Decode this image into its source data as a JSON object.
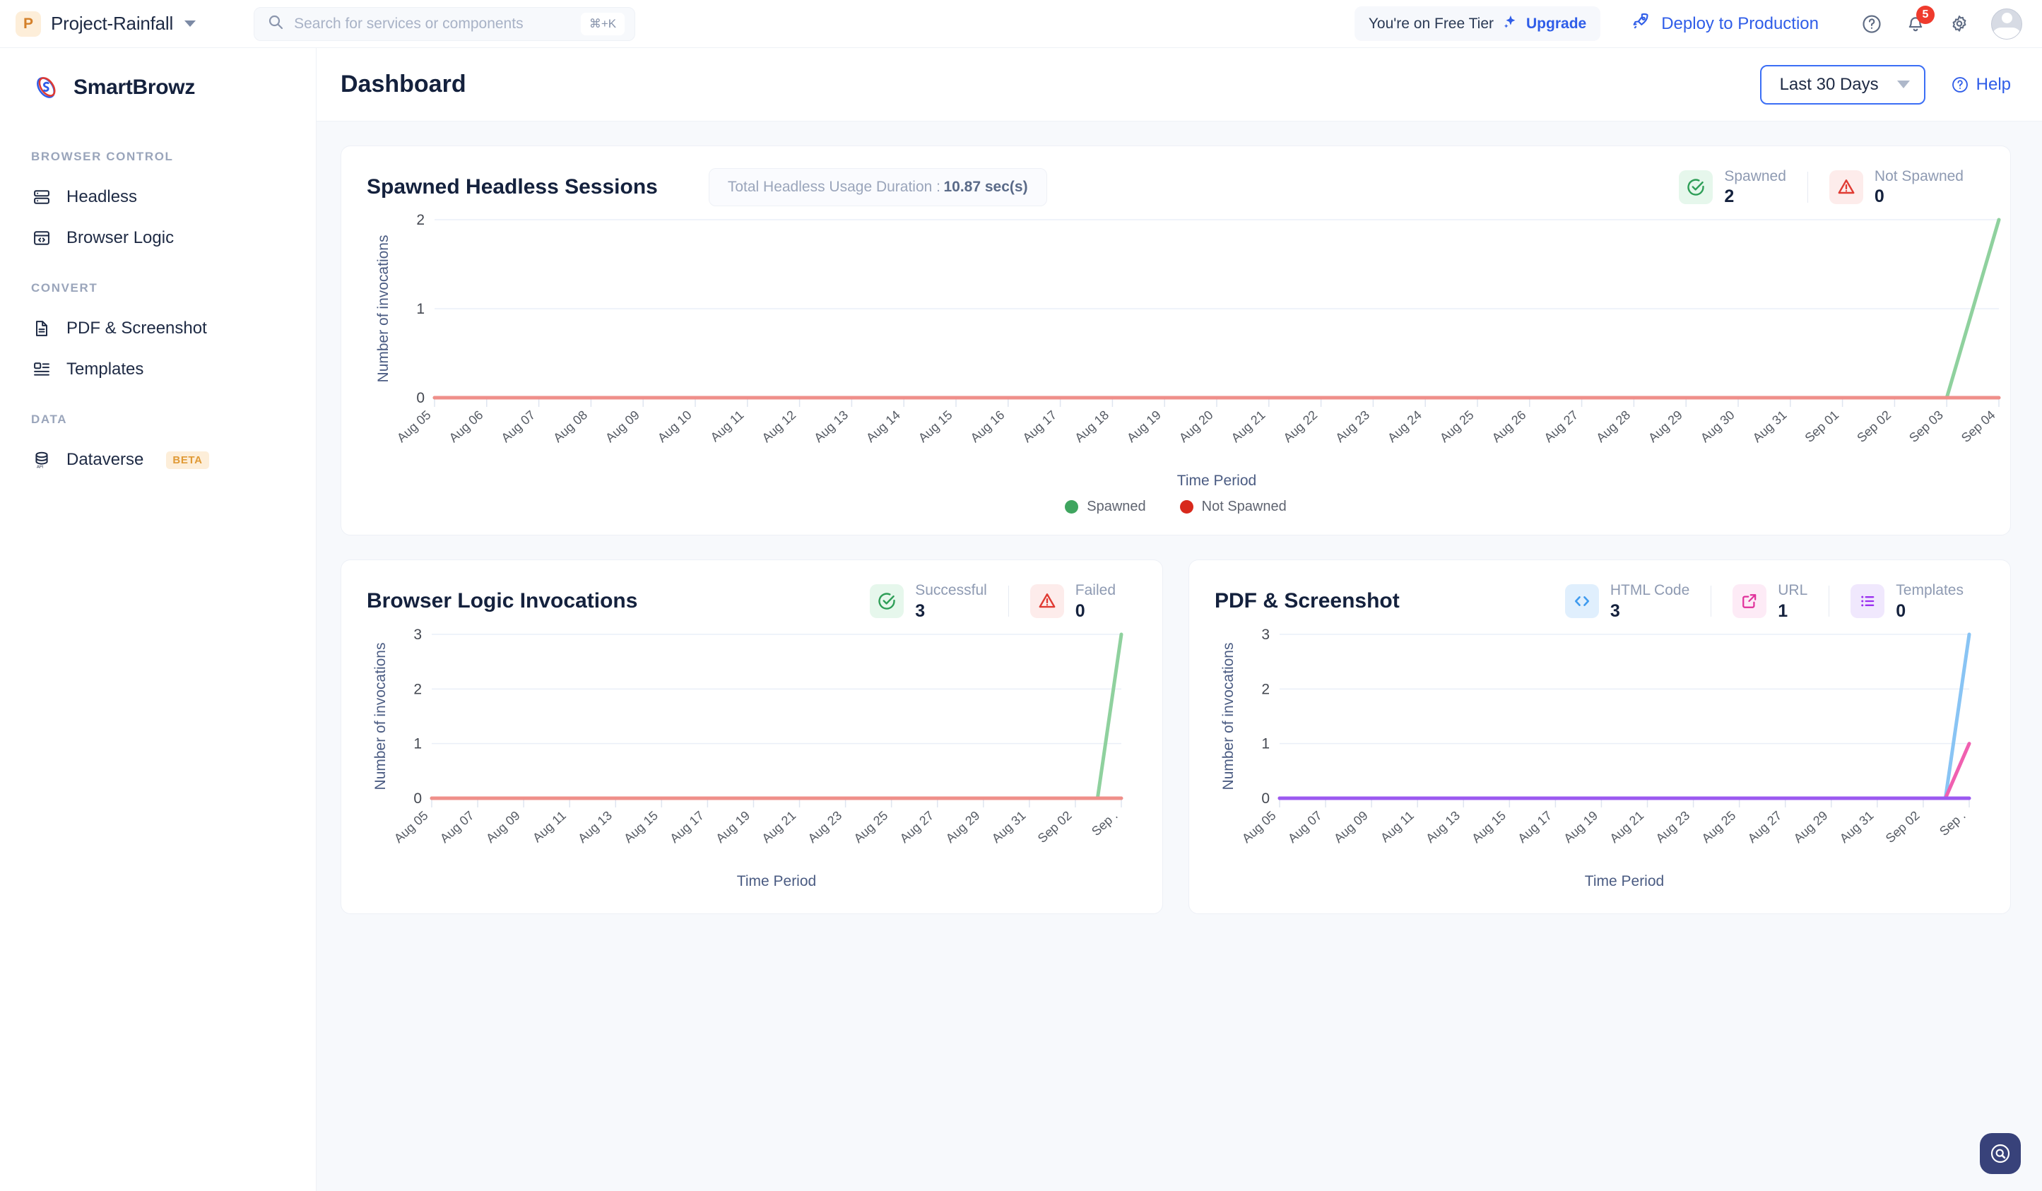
{
  "topbar": {
    "project_initial": "P",
    "project_name": "Project-Rainfall",
    "search_placeholder": "Search for services or components",
    "search_value": "",
    "search_shortcut": "⌘+K",
    "tier_text": "You're on Free Tier",
    "upgrade_label": "Upgrade",
    "deploy_label": "Deploy to Production",
    "notification_count": "5"
  },
  "sidebar": {
    "brand": "SmartBrowz",
    "sections": [
      {
        "title": "BROWSER CONTROL",
        "items": [
          {
            "label": "Headless",
            "icon": "server-icon"
          },
          {
            "label": "Browser Logic",
            "icon": "code-window-icon"
          }
        ]
      },
      {
        "title": "CONVERT",
        "items": [
          {
            "label": "PDF & Screenshot",
            "icon": "document-icon"
          },
          {
            "label": "Templates",
            "icon": "layout-list-icon"
          }
        ]
      },
      {
        "title": "DATA",
        "items": [
          {
            "label": "Dataverse",
            "icon": "database-api-icon",
            "badge": "BETA"
          }
        ]
      }
    ]
  },
  "page": {
    "title": "Dashboard",
    "range_label": "Last 30 Days",
    "help_label": "Help"
  },
  "cards": {
    "headless": {
      "title": "Spawned Headless Sessions",
      "duration_label": "Total Headless Usage Duration :",
      "duration_value": "10.87 sec(s)",
      "stats": [
        {
          "label": "Spawned",
          "value": "2",
          "icon": "check-circle-icon",
          "tone": "green"
        },
        {
          "label": "Not Spawned",
          "value": "0",
          "icon": "warning-triangle-icon",
          "tone": "red"
        }
      ]
    },
    "browser_logic": {
      "title": "Browser Logic Invocations",
      "stats": [
        {
          "label": "Successful",
          "value": "3",
          "icon": "check-circle-icon",
          "tone": "green"
        },
        {
          "label": "Failed",
          "value": "0",
          "icon": "warning-triangle-icon",
          "tone": "red"
        }
      ]
    },
    "pdf_screenshot": {
      "title": "PDF & Screenshot",
      "stats": [
        {
          "label": "HTML Code",
          "value": "3",
          "icon": "code-brackets-icon",
          "tone": "blue"
        },
        {
          "label": "URL",
          "value": "1",
          "icon": "external-link-icon",
          "tone": "pink"
        },
        {
          "label": "Templates",
          "value": "0",
          "icon": "list-icon",
          "tone": "purple"
        }
      ]
    }
  },
  "colors": {
    "accent_blue": "#2f5de8",
    "spawned_green": "#8fd19e",
    "not_spawned_red": "#ef8f8a",
    "html_blue": "#89c4f4",
    "url_pink": "#f060b0",
    "templates_purple": "#9b59f0",
    "beta_amber": "#e09a36"
  },
  "chart_data": [
    {
      "id": "spawned-headless-sessions-chart",
      "type": "line",
      "title": "Spawned Headless Sessions",
      "xlabel": "Time Period",
      "ylabel": "Number of invocations",
      "ylim": [
        0,
        2
      ],
      "yticks": [
        0,
        1,
        2
      ],
      "grid": true,
      "legend_position": "bottom",
      "x": [
        "Aug 05",
        "Aug 06",
        "Aug 07",
        "Aug 08",
        "Aug 09",
        "Aug 10",
        "Aug 11",
        "Aug 12",
        "Aug 13",
        "Aug 14",
        "Aug 15",
        "Aug 16",
        "Aug 17",
        "Aug 18",
        "Aug 19",
        "Aug 20",
        "Aug 21",
        "Aug 22",
        "Aug 23",
        "Aug 24",
        "Aug 25",
        "Aug 26",
        "Aug 27",
        "Aug 28",
        "Aug 29",
        "Aug 30",
        "Aug 31",
        "Sep 01",
        "Sep 02",
        "Sep 03",
        "Sep 04"
      ],
      "tick_labels": [
        "Aug 05",
        "Aug 06",
        "Aug 07",
        "Aug 08",
        "Aug 09",
        "Aug 10",
        "Aug 11",
        "Aug 12",
        "Aug 13",
        "Aug 14",
        "Aug 15",
        "Aug 16",
        "Aug 17",
        "Aug 18",
        "Aug 19",
        "Aug 20",
        "Aug 21",
        "Aug 22",
        "Aug 23",
        "Aug 24",
        "Aug 25",
        "Aug 26",
        "Aug 27",
        "Aug 28",
        "Aug 29",
        "Aug 30",
        "Aug 31",
        "Sep 01",
        "Sep 02",
        "Sep 03",
        "Sep 04"
      ],
      "series": [
        {
          "name": "Spawned",
          "color": "#8fd19e",
          "values": [
            0,
            0,
            0,
            0,
            0,
            0,
            0,
            0,
            0,
            0,
            0,
            0,
            0,
            0,
            0,
            0,
            0,
            0,
            0,
            0,
            0,
            0,
            0,
            0,
            0,
            0,
            0,
            0,
            0,
            0,
            2
          ]
        },
        {
          "name": "Not Spawned",
          "color": "#ef8f8a",
          "values": [
            0,
            0,
            0,
            0,
            0,
            0,
            0,
            0,
            0,
            0,
            0,
            0,
            0,
            0,
            0,
            0,
            0,
            0,
            0,
            0,
            0,
            0,
            0,
            0,
            0,
            0,
            0,
            0,
            0,
            0,
            0
          ]
        }
      ]
    },
    {
      "id": "browser-logic-invocations-chart",
      "type": "line",
      "title": "Browser Logic Invocations",
      "xlabel": "Time Period",
      "ylabel": "Number of invocations",
      "ylim": [
        0,
        3
      ],
      "yticks": [
        0,
        1,
        2,
        3
      ],
      "grid": true,
      "legend_position": "none",
      "x": [
        "Aug 05",
        "Aug 06",
        "Aug 07",
        "Aug 08",
        "Aug 09",
        "Aug 10",
        "Aug 11",
        "Aug 12",
        "Aug 13",
        "Aug 14",
        "Aug 15",
        "Aug 16",
        "Aug 17",
        "Aug 18",
        "Aug 19",
        "Aug 20",
        "Aug 21",
        "Aug 22",
        "Aug 23",
        "Aug 24",
        "Aug 25",
        "Aug 26",
        "Aug 27",
        "Aug 28",
        "Aug 29",
        "Aug 30",
        "Aug 31",
        "Sep 01",
        "Sep 02",
        "Sep 03"
      ],
      "tick_labels": [
        "Aug 05",
        "Aug 07",
        "Aug 09",
        "Aug 11",
        "Aug 13",
        "Aug 15",
        "Aug 17",
        "Aug 19",
        "Aug 21",
        "Aug 23",
        "Aug 25",
        "Aug 27",
        "Aug 29",
        "Aug 31",
        "Sep 02",
        "Sep ."
      ],
      "series": [
        {
          "name": "Successful",
          "color": "#8fd19e",
          "values": [
            0,
            0,
            0,
            0,
            0,
            0,
            0,
            0,
            0,
            0,
            0,
            0,
            0,
            0,
            0,
            0,
            0,
            0,
            0,
            0,
            0,
            0,
            0,
            0,
            0,
            0,
            0,
            0,
            0,
            3
          ]
        },
        {
          "name": "Failed",
          "color": "#ef8f8a",
          "values": [
            0,
            0,
            0,
            0,
            0,
            0,
            0,
            0,
            0,
            0,
            0,
            0,
            0,
            0,
            0,
            0,
            0,
            0,
            0,
            0,
            0,
            0,
            0,
            0,
            0,
            0,
            0,
            0,
            0,
            0
          ]
        }
      ]
    },
    {
      "id": "pdf-screenshot-chart",
      "type": "line",
      "title": "PDF & Screenshot",
      "xlabel": "Time Period",
      "ylabel": "Number of invocations",
      "ylim": [
        0,
        3
      ],
      "yticks": [
        0,
        1,
        2,
        3
      ],
      "grid": true,
      "legend_position": "none",
      "x": [
        "Aug 05",
        "Aug 06",
        "Aug 07",
        "Aug 08",
        "Aug 09",
        "Aug 10",
        "Aug 11",
        "Aug 12",
        "Aug 13",
        "Aug 14",
        "Aug 15",
        "Aug 16",
        "Aug 17",
        "Aug 18",
        "Aug 19",
        "Aug 20",
        "Aug 21",
        "Aug 22",
        "Aug 23",
        "Aug 24",
        "Aug 25",
        "Aug 26",
        "Aug 27",
        "Aug 28",
        "Aug 29",
        "Aug 30",
        "Aug 31",
        "Sep 01",
        "Sep 02",
        "Sep 03"
      ],
      "tick_labels": [
        "Aug 05",
        "Aug 07",
        "Aug 09",
        "Aug 11",
        "Aug 13",
        "Aug 15",
        "Aug 17",
        "Aug 19",
        "Aug 21",
        "Aug 23",
        "Aug 25",
        "Aug 27",
        "Aug 29",
        "Aug 31",
        "Sep 02",
        "Sep ."
      ],
      "series": [
        {
          "name": "HTML Code",
          "color": "#89c4f4",
          "values": [
            0,
            0,
            0,
            0,
            0,
            0,
            0,
            0,
            0,
            0,
            0,
            0,
            0,
            0,
            0,
            0,
            0,
            0,
            0,
            0,
            0,
            0,
            0,
            0,
            0,
            0,
            0,
            0,
            0,
            3
          ]
        },
        {
          "name": "URL",
          "color": "#f060b0",
          "values": [
            0,
            0,
            0,
            0,
            0,
            0,
            0,
            0,
            0,
            0,
            0,
            0,
            0,
            0,
            0,
            0,
            0,
            0,
            0,
            0,
            0,
            0,
            0,
            0,
            0,
            0,
            0,
            0,
            0,
            1
          ]
        },
        {
          "name": "Templates",
          "color": "#9b59f0",
          "values": [
            0,
            0,
            0,
            0,
            0,
            0,
            0,
            0,
            0,
            0,
            0,
            0,
            0,
            0,
            0,
            0,
            0,
            0,
            0,
            0,
            0,
            0,
            0,
            0,
            0,
            0,
            0,
            0,
            0,
            0
          ]
        }
      ]
    }
  ]
}
